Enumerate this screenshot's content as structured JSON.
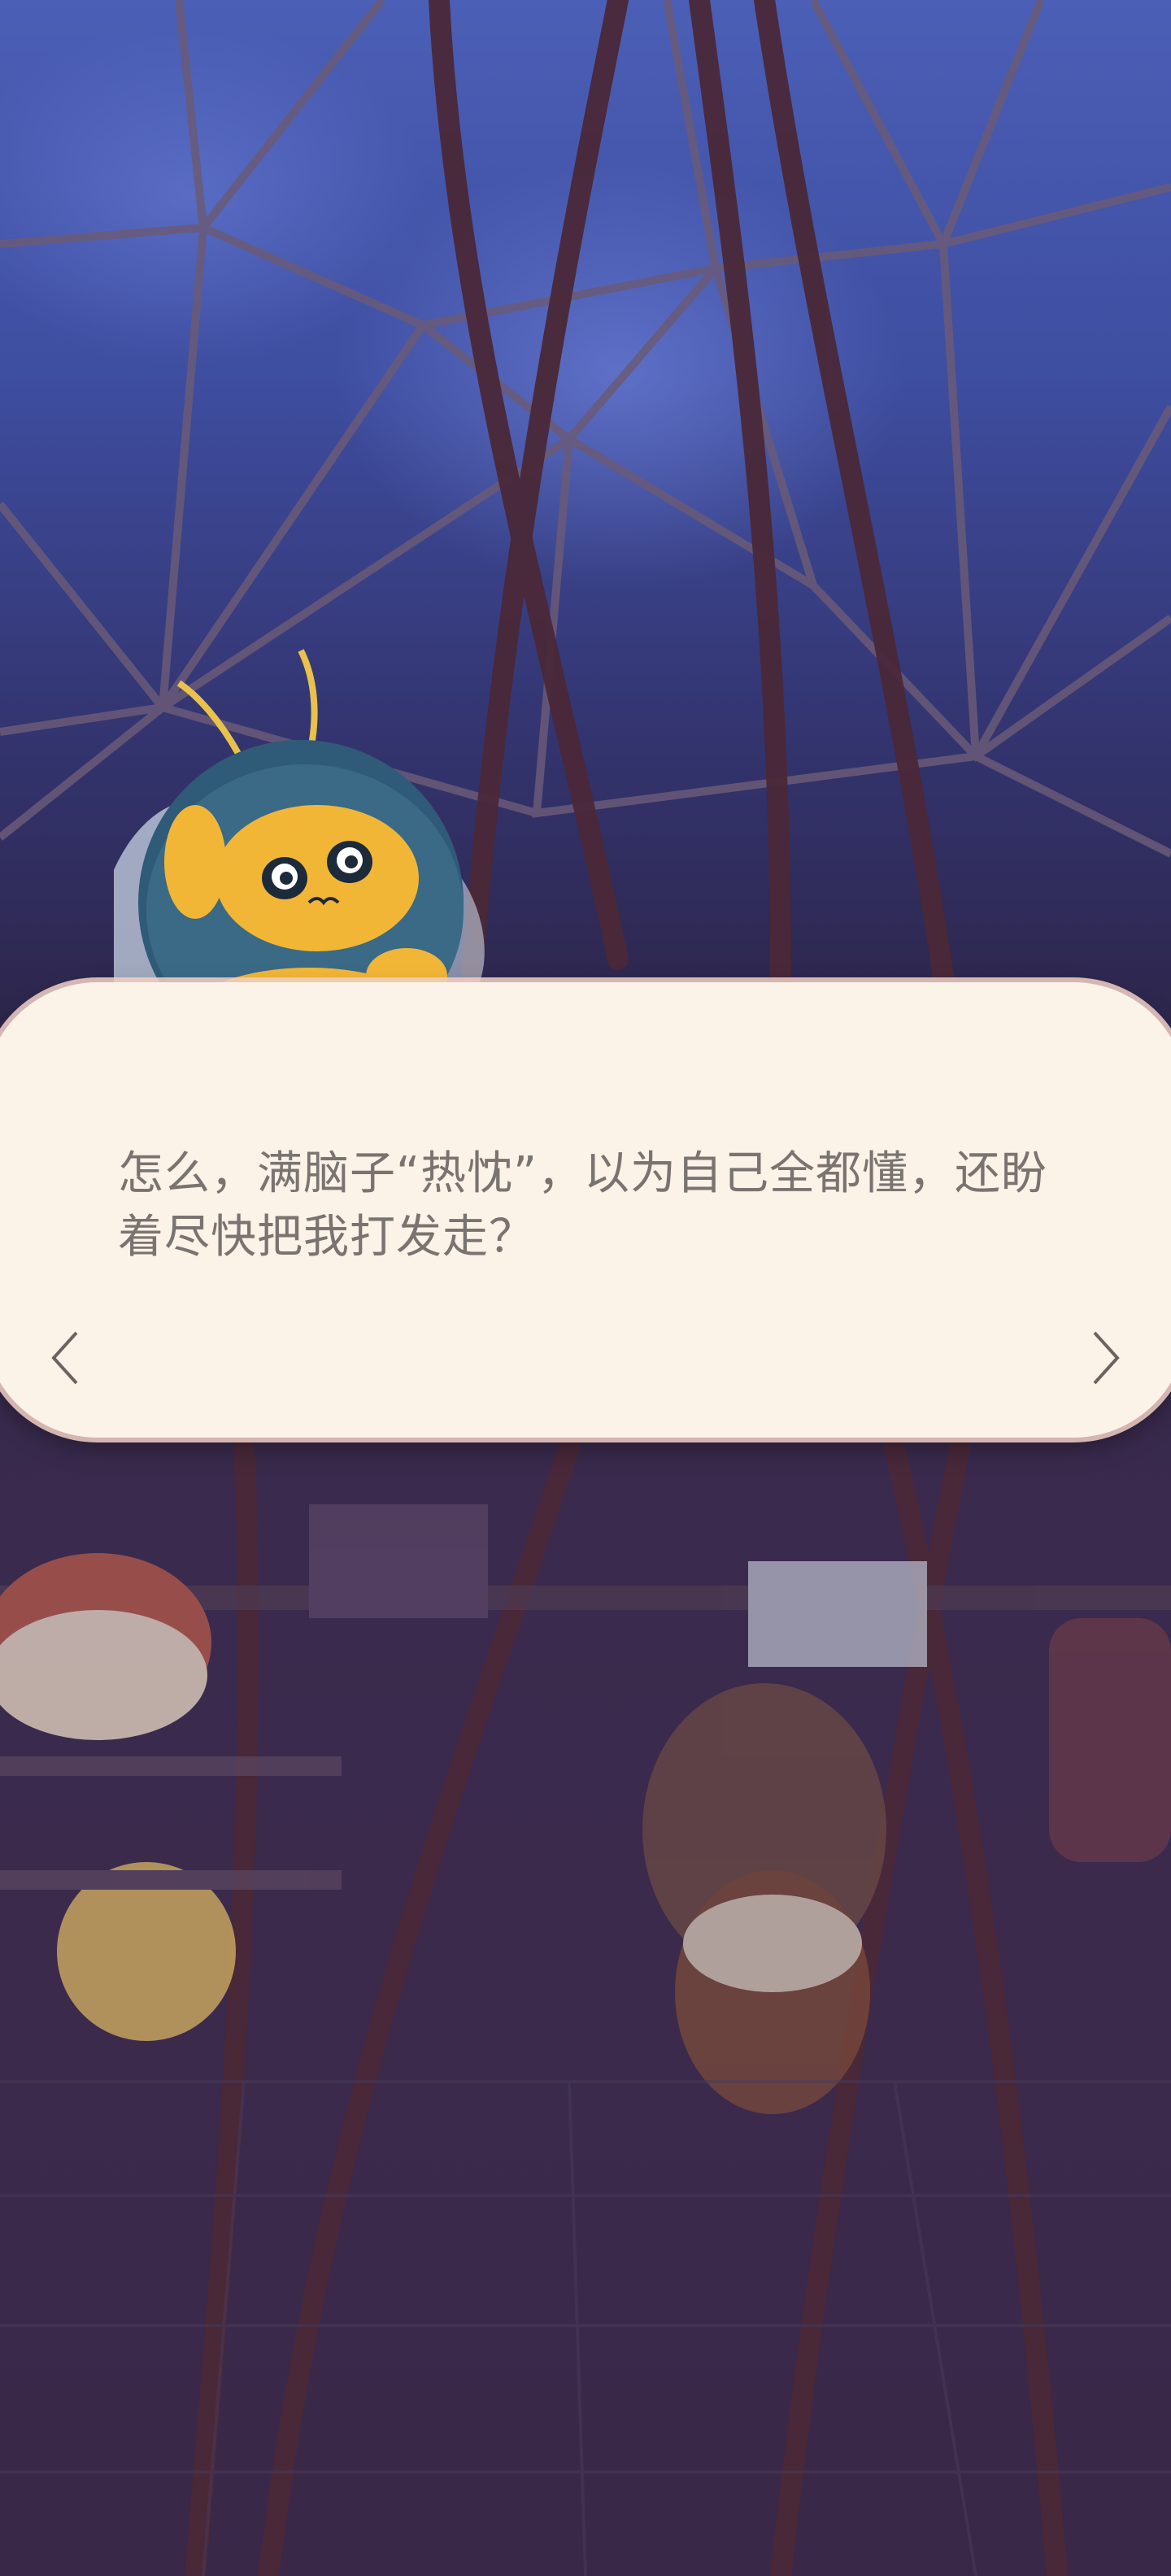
{
  "dialog": {
    "text": "怎么，满脑子“热忱”，以为自己全都懂，还盼着尽快把我打发走？"
  },
  "navigation": {
    "prev_icon": "chevron-left-icon",
    "next_icon": "chevron-right-icon"
  },
  "colors": {
    "dialog_background": "#fbf2e8",
    "dialog_border": "#f2d0c6",
    "dialog_text": "#7a7470",
    "sky": "#4b5fb6",
    "room": "#3a2848"
  }
}
